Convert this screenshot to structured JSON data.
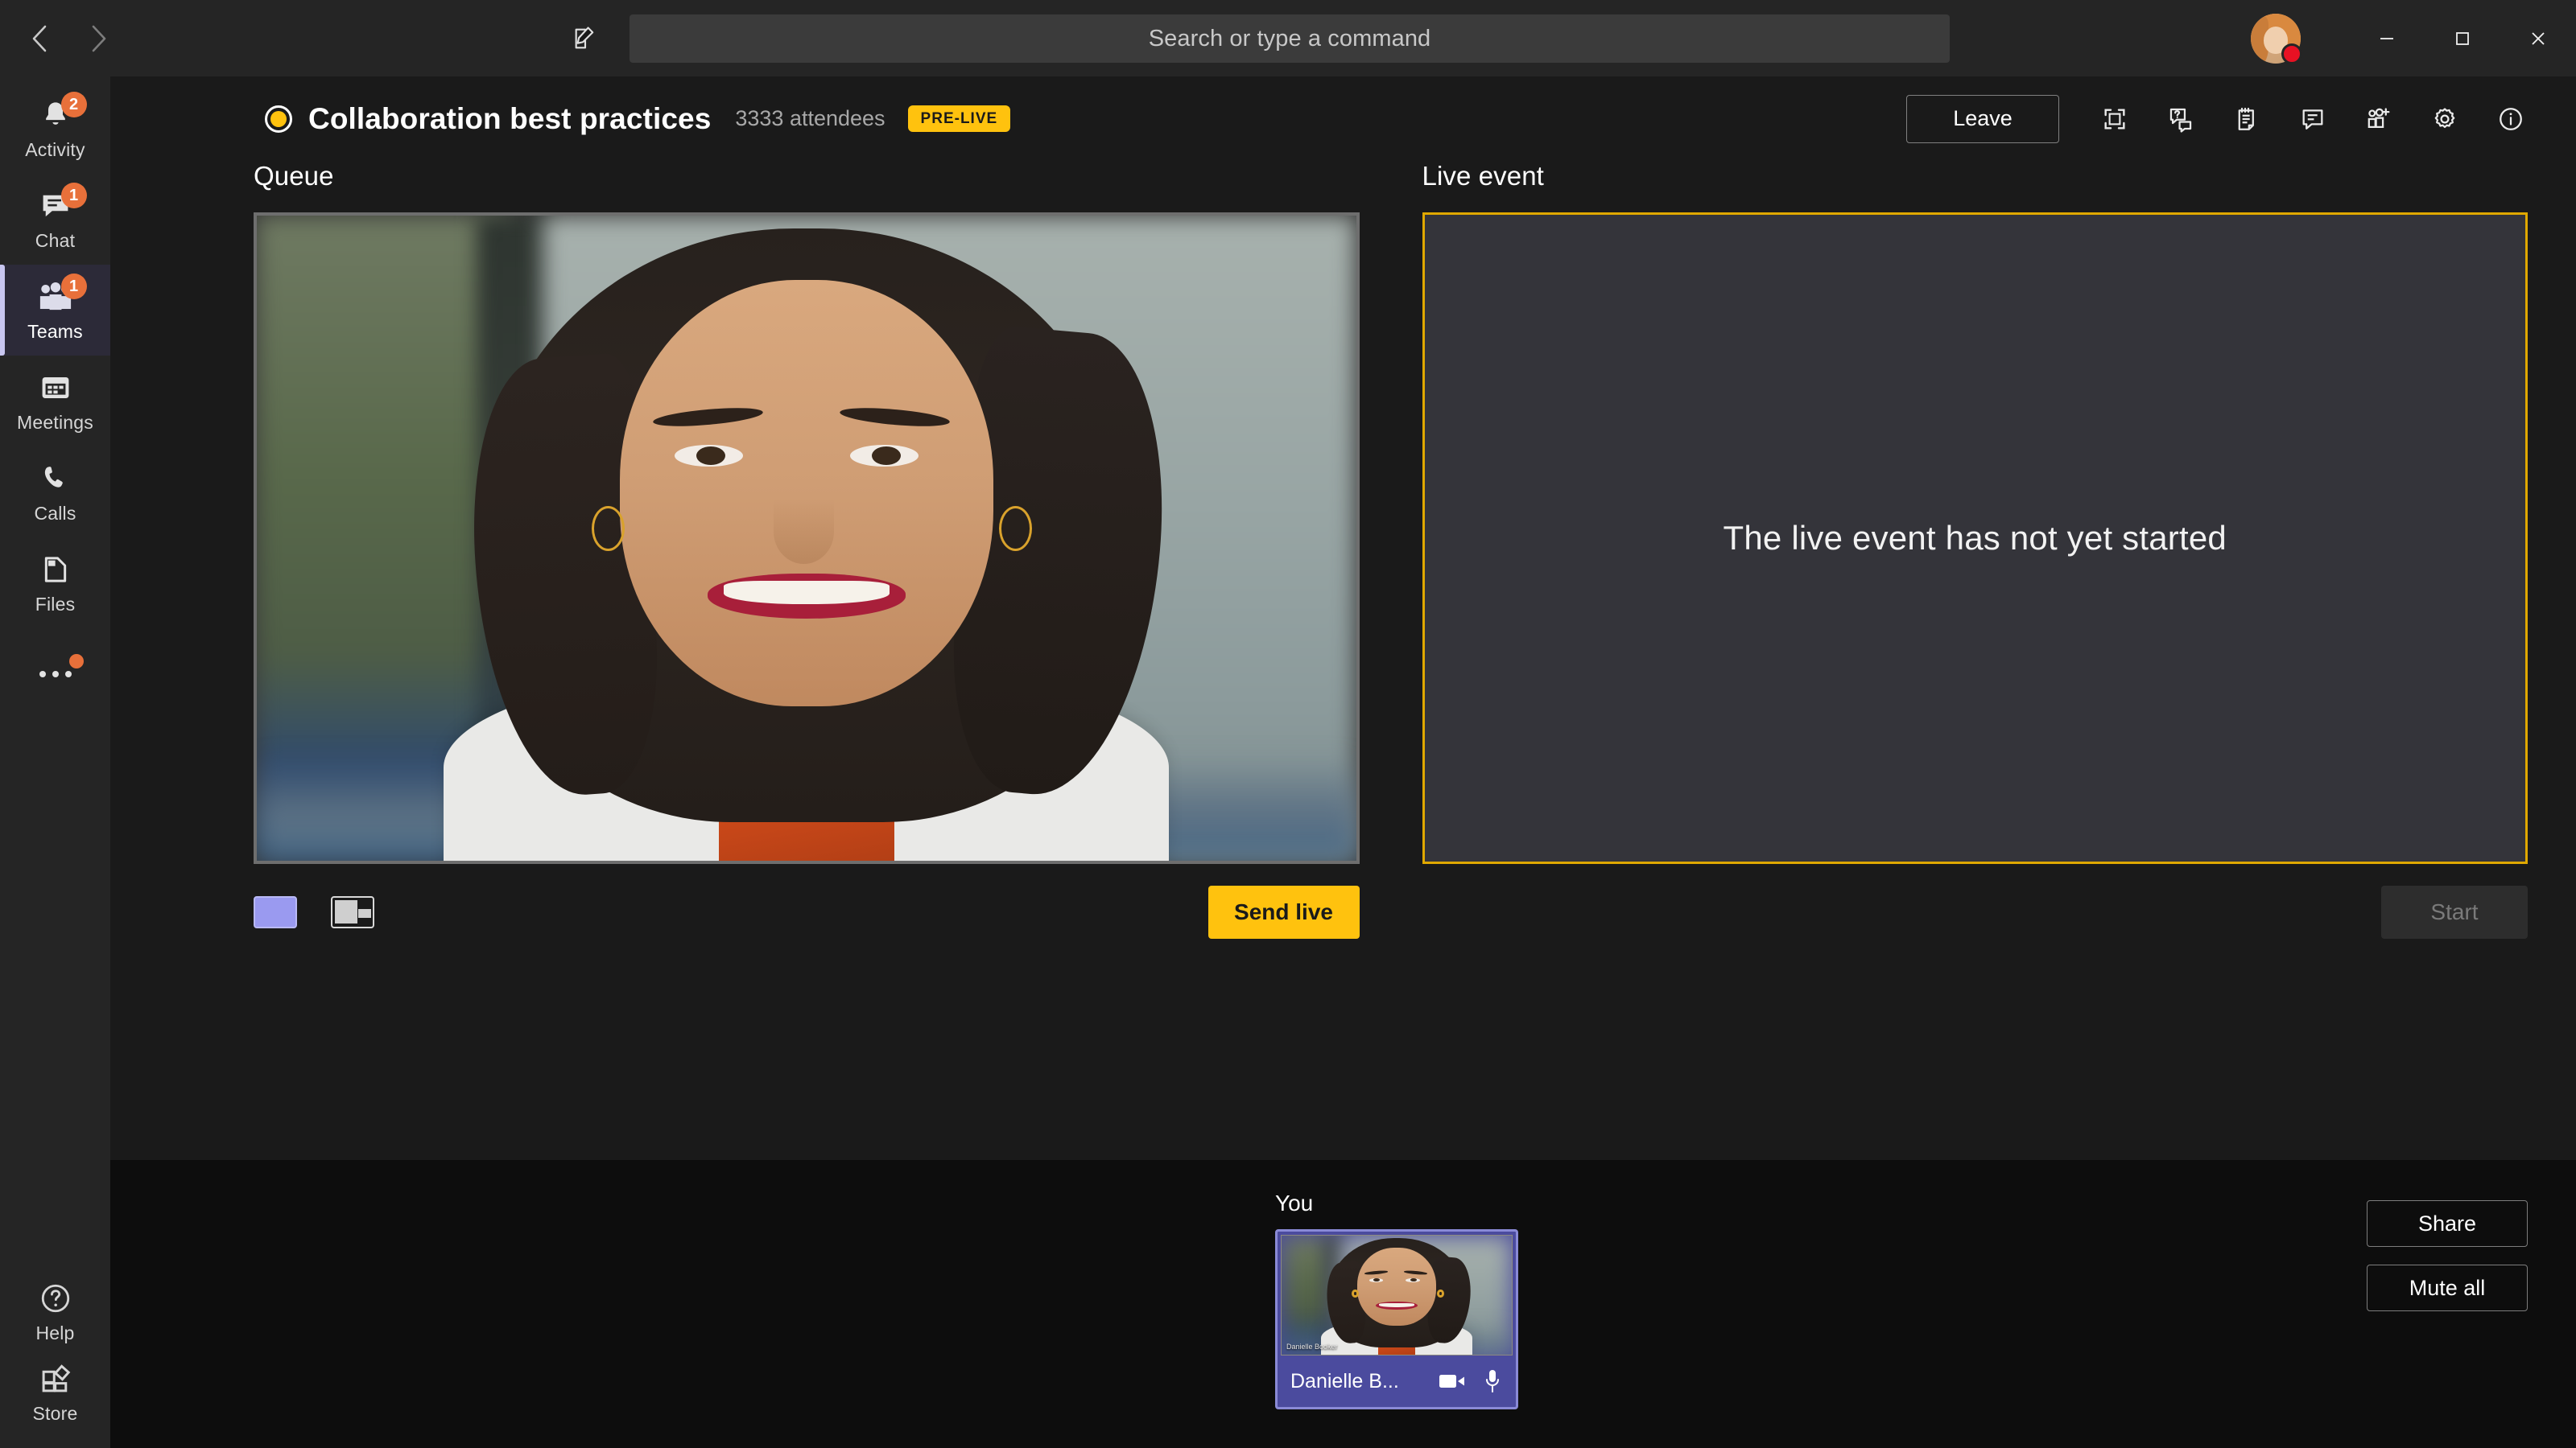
{
  "titlebar": {
    "back_label": "Back",
    "forward_label": "Forward",
    "compose_icon": "compose-icon",
    "search": {
      "placeholder": "Search or type a command",
      "value": ""
    },
    "minimize_label": "Minimize",
    "maximize_label": "Maximize",
    "close_label": "Close",
    "avatar_status": "busy",
    "status_color": "#e81123"
  },
  "rail": {
    "items": [
      {
        "name": "activity",
        "label": "Activity",
        "badge": "2"
      },
      {
        "name": "chat",
        "label": "Chat",
        "badge": "1"
      },
      {
        "name": "teams",
        "label": "Teams",
        "badge": "1",
        "active": true
      },
      {
        "name": "meetings",
        "label": "Meetings",
        "badge": ""
      },
      {
        "name": "calls",
        "label": "Calls",
        "badge": ""
      },
      {
        "name": "files",
        "label": "Files",
        "badge": ""
      },
      {
        "name": "more",
        "label": "",
        "badge": "dot"
      }
    ],
    "bottom": [
      {
        "name": "help",
        "label": "Help"
      },
      {
        "name": "store",
        "label": "Store"
      }
    ]
  },
  "meeting": {
    "title": "Collaboration best practices",
    "attendees": "3333 attendees",
    "status_badge": "PRE-LIVE",
    "status_badge_color": "#ffc20e",
    "leave_label": "Leave",
    "toolbar_icons": [
      "fullscreen-icon",
      "qna-icon",
      "notes-icon",
      "chat-icon",
      "add-people-icon",
      "settings-gear-icon",
      "info-icon"
    ]
  },
  "stage": {
    "queue": {
      "title": "Queue",
      "layout_single_label": "Single layout",
      "layout_split_label": "Split layout",
      "send_live_label": "Send live",
      "send_live_color": "#ffc20e"
    },
    "live_event": {
      "title": "Live event",
      "message": "The live event has not yet started",
      "start_label": "Start",
      "start_disabled": true,
      "border_color": "#e0a800"
    }
  },
  "bottom": {
    "you_label": "You",
    "self_tile": {
      "name": "Danielle B...",
      "video_name_tag": "Danielle Booker",
      "camera_icon": "camera-icon",
      "mic_icon": "microphone-icon",
      "accent_color": "#4b4b9e"
    },
    "share_label": "Share",
    "mute_all_label": "Mute all"
  }
}
